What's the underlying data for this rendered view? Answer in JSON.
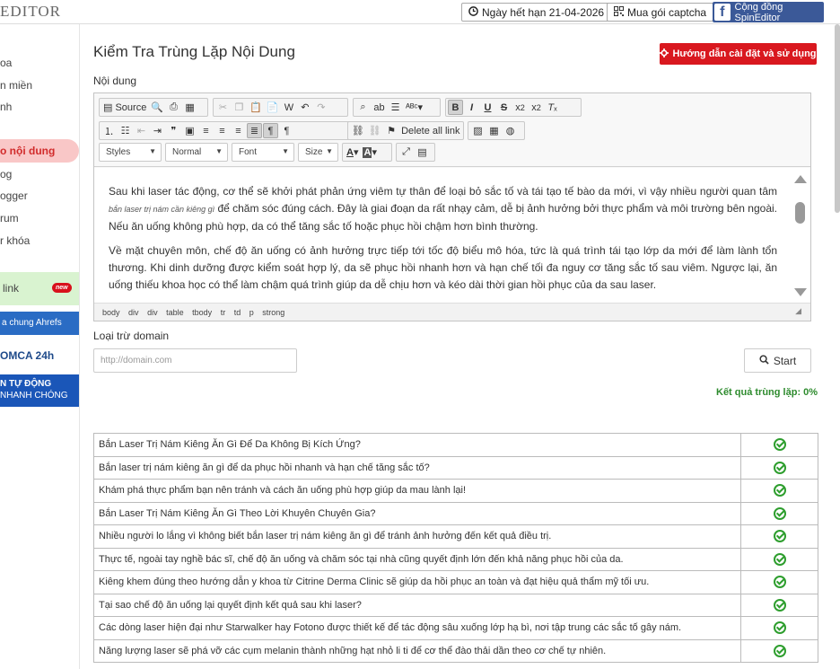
{
  "app": {
    "logo": "EDITOR"
  },
  "topbar": {
    "expiry_label": "Ngày hết hạn 21-04-2026",
    "captcha_label": "Mua gói captcha",
    "community_label": "Cộng đồng SpinEditor"
  },
  "sidebar": {
    "items": [
      "oa",
      "n miền",
      "nh",
      "o nội dung",
      "og",
      "ogger",
      "rum",
      "r khóa"
    ],
    "link_label": "link",
    "new_badge": "new",
    "ahrefs_label": "a chung Ahrefs",
    "dmca_label": "OMCA 24h",
    "promo_line1": "N TỰ ĐỘNG",
    "promo_line2": "NHANH CHÓNG"
  },
  "page": {
    "title": "Kiểm Tra Trùng Lặp Nội Dung",
    "guide_button": "Hướng dẫn cài đặt và sử dụng",
    "content_label": "Nội dung"
  },
  "toolbar": {
    "source": "Source",
    "delete_all_link": "Delete all link",
    "styles": "Styles",
    "format": "Normal",
    "font": "Font",
    "size": "Size"
  },
  "editor": {
    "p1_a": "Sau khi laser tác động, cơ thể sẽ khởi phát phản ứng viêm tự thân để loại bỏ sắc tố và tái tạo tế bào da mới, vì vậy nhiều người quan tâm ",
    "p1_keyword": "bắn laser trị nám cần kiêng gì",
    "p1_b": " để chăm sóc đúng cách. Đây là giai đoạn da rất nhạy cảm, dễ bị ảnh hưởng bởi thực phẩm và môi trường bên ngoài. Nếu ăn uống không phù hợp, da có thể tăng sắc tố hoặc phục hồi chậm hơn bình thường.",
    "p2": "Về mặt chuyên môn, chế độ ăn uống có ảnh hưởng trực tiếp tới tốc độ biểu mô hóa, tức là quá trình tái tạo lớp da mới để làm lành tổn thương. Khi dinh dưỡng được kiểm soát hợp lý, da sẽ phục hồi nhanh hơn và hạn chế tối đa nguy cơ tăng sắc tố sau viêm. Ngược lại, ăn uống thiếu khoa học có thể làm chậm quá trình giúp da dễ chịu hơn và kéo dài thời gian hồi phục của da sau laser.",
    "path": [
      "body",
      "div",
      "div",
      "table",
      "tbody",
      "tr",
      "td",
      "p",
      "strong"
    ]
  },
  "exclude": {
    "label": "Loại trừ domain",
    "placeholder": "http://domain.com",
    "start_button": "Start"
  },
  "result": {
    "label": "Kết quả trùng lặp: 0%"
  },
  "results_table": [
    "Bắn Laser Trị Nám Kiêng Ăn Gì Để Da Không Bị Kích Ứng?",
    "Bắn laser trị nám kiêng ăn gì để da phục hồi nhanh và hạn chế tăng sắc tố?",
    "Khám phá thực phẩm bạn nên tránh và cách ăn uống phù hợp giúp da mau lành lại!",
    "Bắn Laser Trị Nám Kiêng Ăn Gì Theo Lời Khuyên Chuyên Gia?",
    "Nhiều người lo lắng vì không biết bắn laser trị nám kiêng ăn gì để tránh ảnh hưởng đến kết quả điều trị.",
    "Thực tế, ngoài tay nghề bác sĩ, chế độ ăn uống và chăm sóc tại nhà cũng quyết định lớn đến khả năng phục hồi của da.",
    "Kiêng khem đúng theo hướng dẫn y khoa từ Citrine Derma Clinic sẽ giúp da hồi phục an toàn và đạt hiệu quả thẩm mỹ tối ưu.",
    "Tại sao chế độ ăn uống lại quyết định kết quả sau khi laser?",
    "Các dòng laser hiện đại như Starwalker hay Fotono được thiết kế để tác động sâu xuống lớp hạ bì, nơi tập trung các sắc tố gây nám.",
    "Năng lượng laser sẽ phá vỡ các cụm melanin thành những hạt nhỏ li ti để cơ thể đào thải dần theo cơ chế tự nhiên."
  ]
}
